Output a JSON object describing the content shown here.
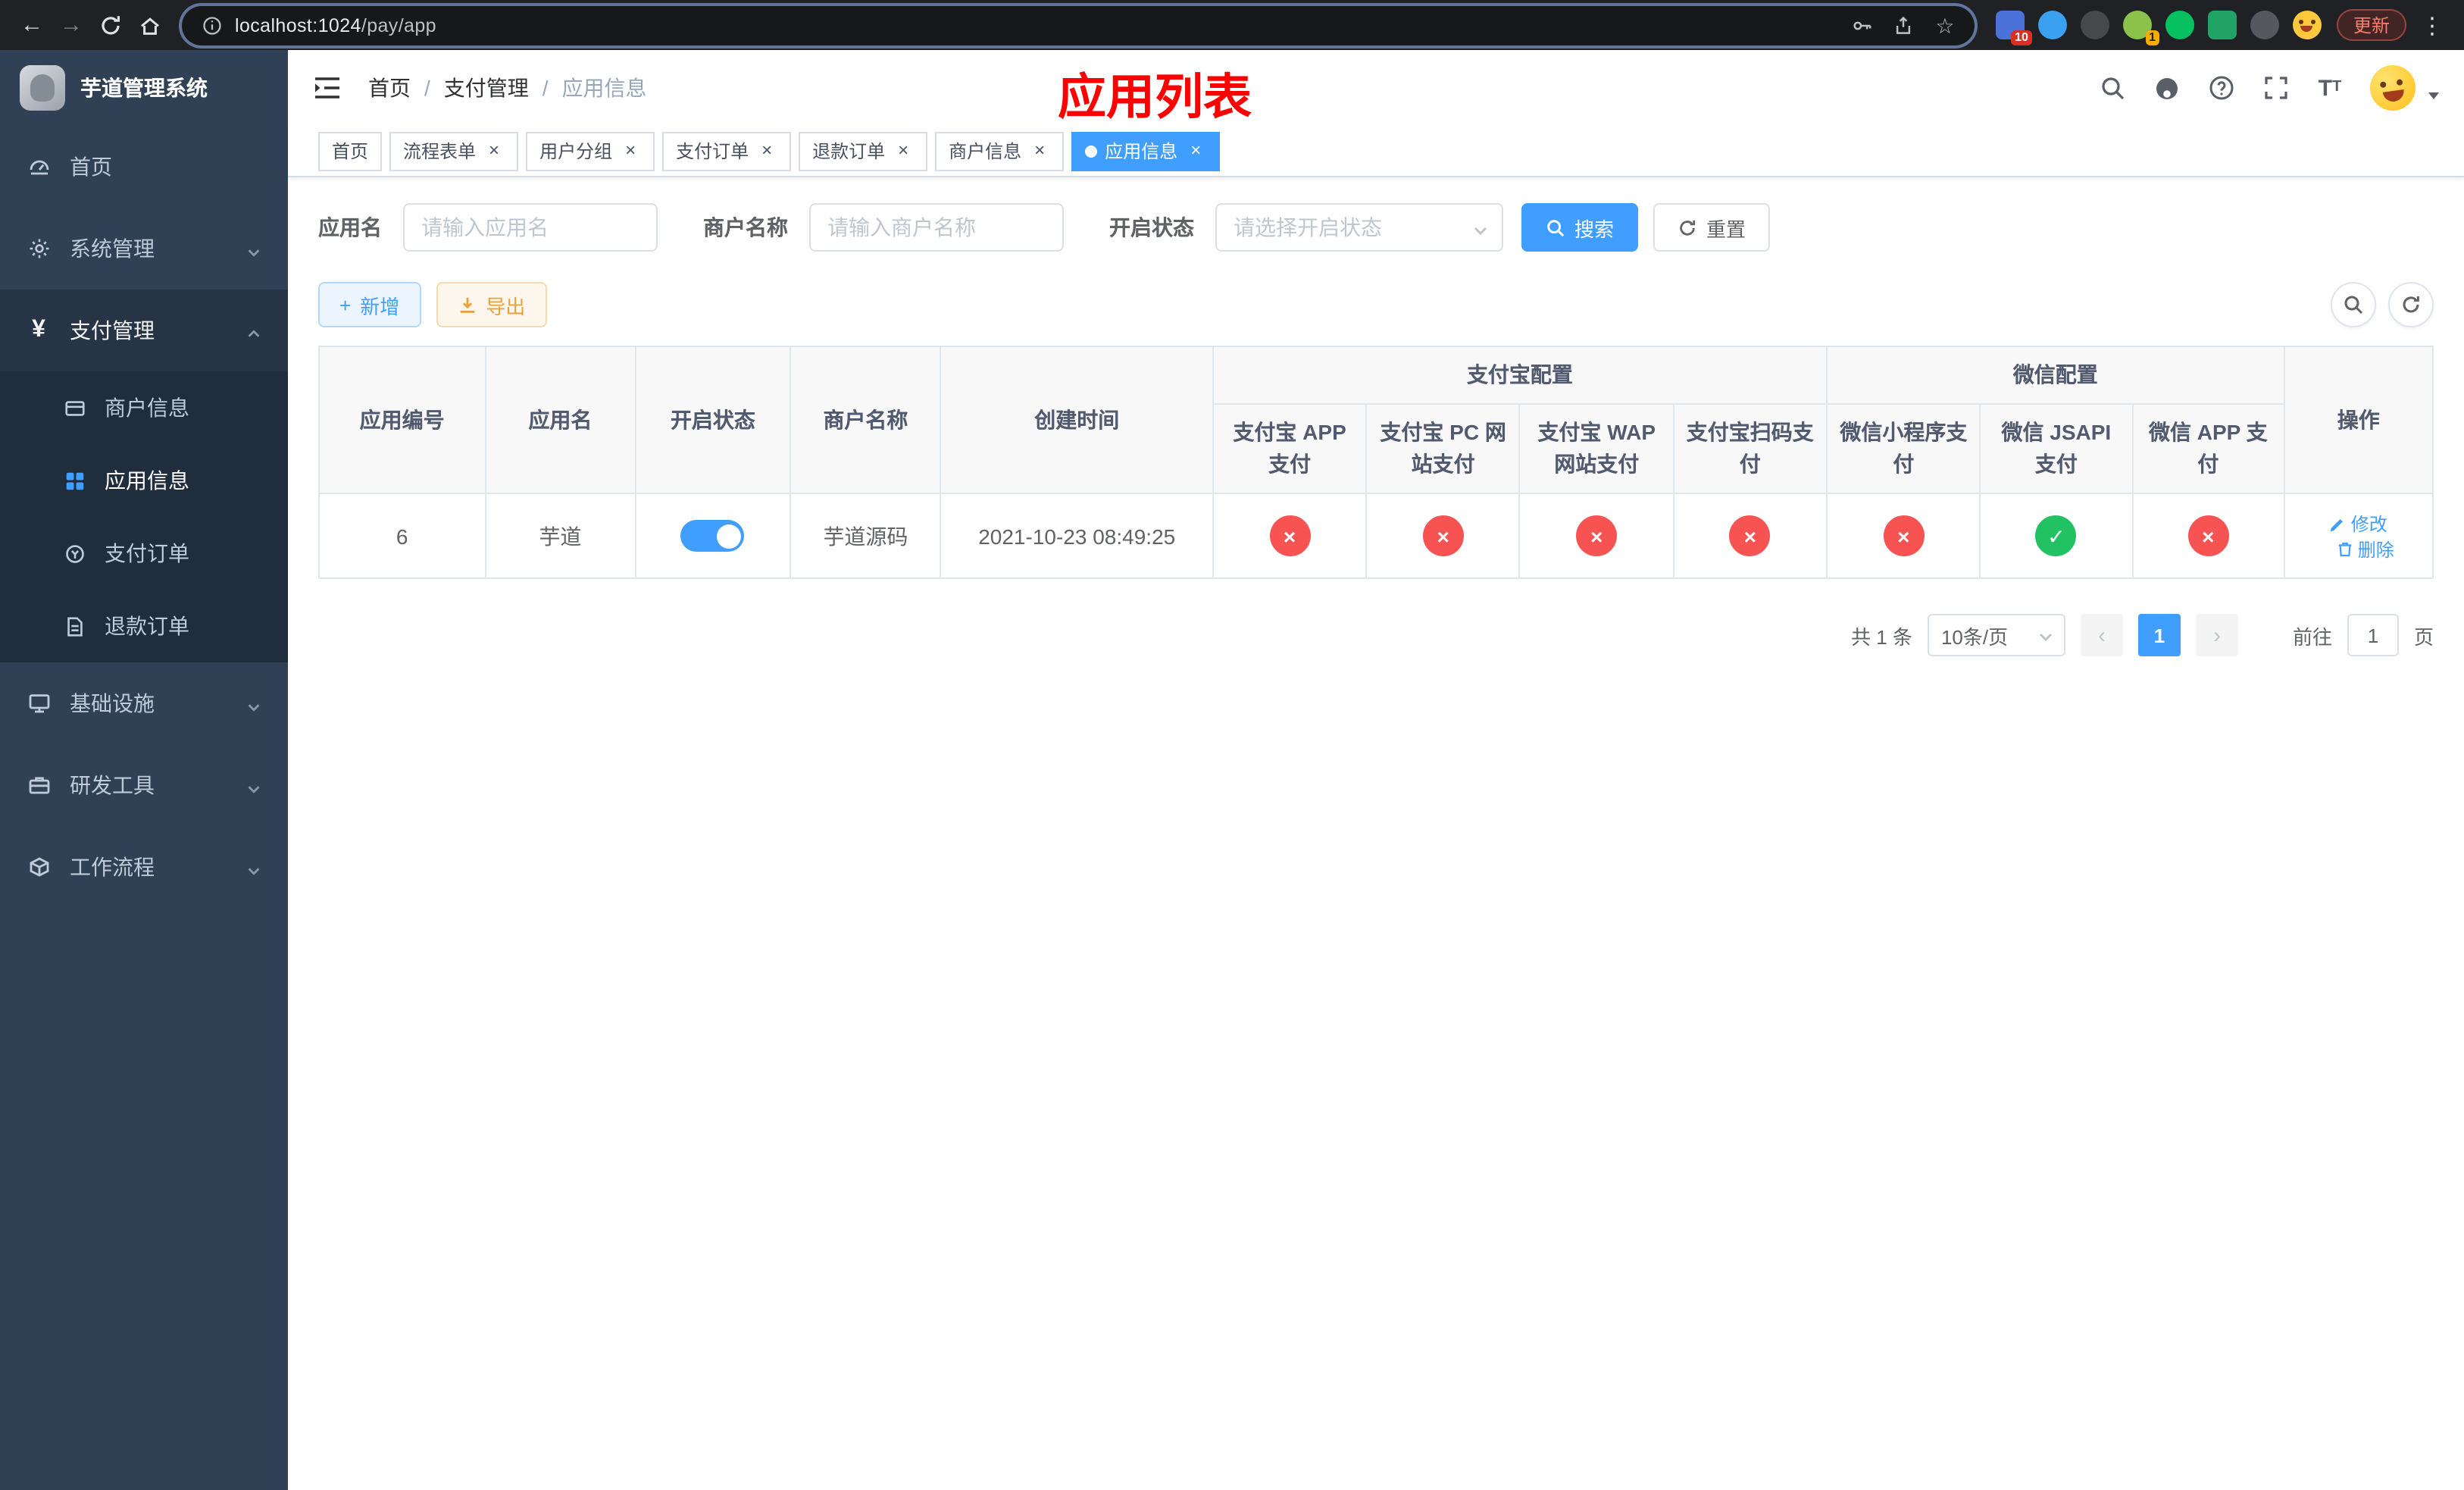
{
  "browser": {
    "url_host": "localhost:1024",
    "url_path": "/pay/app",
    "update_label": "更新",
    "extension_badge_blue": "10",
    "extension_badge_green": "1"
  },
  "sidebar": {
    "title": "芋道管理系统",
    "items": {
      "home": "首页",
      "system": "系统管理",
      "payment": "支付管理",
      "merchant": "商户信息",
      "app_info": "应用信息",
      "pay_order": "支付订单",
      "refund_order": "退款订单",
      "infrastructure": "基础设施",
      "dev_tools": "研发工具",
      "workflow": "工作流程"
    }
  },
  "navbar": {
    "breadcrumb": {
      "home": "首页",
      "section": "支付管理",
      "current": "应用信息"
    },
    "annotation": "应用列表"
  },
  "tabs": {
    "home": "首页",
    "flow_form": "流程表单",
    "user_group": "用户分组",
    "pay_order": "支付订单",
    "refund_order": "退款订单",
    "merchant_info": "商户信息",
    "app_info": "应用信息"
  },
  "filters": {
    "app_name_label": "应用名",
    "app_name_placeholder": "请输入应用名",
    "merchant_label": "商户名称",
    "merchant_placeholder": "请输入商户名称",
    "status_label": "开启状态",
    "status_placeholder": "请选择开启状态",
    "search_button": "搜索",
    "reset_button": "重置"
  },
  "toolbar": {
    "add_button": "新增",
    "export_button": "导出"
  },
  "table": {
    "group_headers": {
      "alipay": "支付宝配置",
      "wechat": "微信配置"
    },
    "headers": {
      "app_id": "应用编号",
      "app_name": "应用名",
      "status": "开启状态",
      "merchant": "商户名称",
      "create_time": "创建时间",
      "alipay_app": "支付宝 APP 支付",
      "alipay_pc": "支付宝 PC 网站支付",
      "alipay_wap": "支付宝 WAP 网站支付",
      "alipay_qr": "支付宝扫码支付",
      "wx_mini": "微信小程序支付",
      "wx_jsapi": "微信 JSAPI 支付",
      "wx_app": "微信 APP 支付",
      "actions": "操作"
    },
    "row": {
      "app_id": "6",
      "app_name": "芋道",
      "status_enabled": true,
      "merchant": "芋道源码",
      "create_time": "2021-10-23 08:49:25",
      "channels": {
        "alipay_app": false,
        "alipay_pc": false,
        "alipay_wap": false,
        "alipay_qr": false,
        "wx_mini": false,
        "wx_jsapi": true,
        "wx_app": false
      },
      "edit_label": "修改",
      "delete_label": "删除"
    }
  },
  "glyphs": {
    "ok": "✓",
    "fail": "×"
  },
  "pagination": {
    "total": "共 1 条",
    "page_size": "10条/页",
    "current_page": "1",
    "goto_label": "前往",
    "goto_value": "1",
    "page_suffix": "页"
  },
  "colors": {
    "primary": "#409eff",
    "danger": "#f85353",
    "success": "#22c262",
    "warning": "#e6a23c",
    "annotation": "#ff0000",
    "sidebar_bg": "#304156"
  }
}
